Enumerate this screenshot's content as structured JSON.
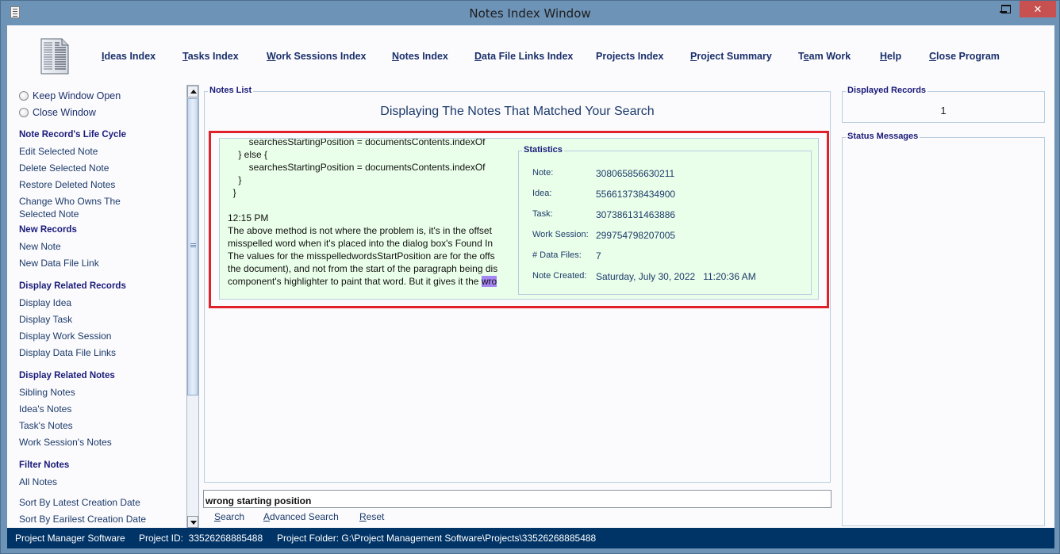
{
  "window": {
    "title": "Notes Index Window"
  },
  "nav": [
    {
      "label": "Ideas Index",
      "mnemonic": "I"
    },
    {
      "label": "Tasks Index",
      "mnemonic": "T"
    },
    {
      "label": "Work Sessions Index",
      "mnemonic": "W"
    },
    {
      "label": "Notes Index",
      "mnemonic": "N"
    },
    {
      "label": "Data File Links Index",
      "mnemonic": "D"
    },
    {
      "label": "Projects Index",
      "mnemonic": ""
    },
    {
      "label": "Project Summary",
      "mnemonic": "P"
    },
    {
      "label": "Team Work",
      "mnemonic": "e"
    },
    {
      "label": "Help",
      "mnemonic": "H"
    },
    {
      "label": "Close Program",
      "mnemonic": "C"
    }
  ],
  "sidebar": {
    "radios": [
      {
        "label": "Keep Window Open",
        "selected": false
      },
      {
        "label": "Close Window",
        "selected": false
      }
    ],
    "sections": [
      {
        "heading": "Note Record's Life Cycle",
        "items": [
          "Edit Selected Note",
          "Delete Selected Note",
          "Restore Deleted Notes",
          "Change Who Owns The Selected Note"
        ]
      },
      {
        "heading": "New Records",
        "items": [
          "New Note",
          "New Data File Link"
        ]
      },
      {
        "heading": "Display Related Records",
        "items": [
          "Display Idea",
          "Display Task",
          "Display Work Session",
          "Display Data File Links"
        ]
      },
      {
        "heading": "Display Related Notes",
        "items": [
          "Sibling Notes",
          "Idea's Notes",
          "Task's Notes",
          "Work Session's Notes"
        ]
      },
      {
        "heading": "Filter Notes",
        "items": [
          "All Notes",
          "Sort By Latest Creation Date",
          "Sort By Earilest Creation Date"
        ]
      }
    ]
  },
  "notes_list": {
    "legend": "Notes List",
    "heading": "Displaying The Notes That Matched Your Search",
    "note": {
      "text_lines": [
        "        searchesStartingPosition = documentsContents.indexOf",
        "    } else {",
        "        searchesStartingPosition = documentsContents.indexOf",
        "    }",
        "  }",
        "",
        "12:15 PM",
        "The above method is not where the problem is, it's in the offset",
        "misspelled word when it's placed into the dialog box's Found In",
        "The values for the misspelledwordsStartPosition are for the offs",
        "the document), and not from the start of the paragraph being dis",
        "component's highlighter to paint that word. But it gives it the "
      ],
      "highlighted_text": "wro",
      "highlight_color": "#a584f3"
    },
    "statistics": {
      "legend": "Statistics",
      "rows": [
        {
          "label": "Note:",
          "value": "308065856630211"
        },
        {
          "label": "Idea:",
          "value": "556613738434900"
        },
        {
          "label": "Task:",
          "value": "307386131463886"
        },
        {
          "label": "Work Session:",
          "value": "299754798207005"
        },
        {
          "label": "# Data Files:",
          "value": "7"
        },
        {
          "label": "Note Created:",
          "value": "Saturday, July 30, 2022   11:20:36 AM"
        }
      ]
    }
  },
  "search": {
    "value": "wrong starting position",
    "actions": [
      {
        "label": "Search",
        "mnemonic": "S"
      },
      {
        "label": "Advanced Search",
        "mnemonic": "A"
      },
      {
        "label": "Reset",
        "mnemonic": "R"
      }
    ]
  },
  "displayed_records": {
    "legend": "Displayed Records",
    "value": "1"
  },
  "status_messages": {
    "legend": "Status Messages"
  },
  "statusbar": {
    "app_name": "Project Manager Software",
    "project_id": "Project ID:  33526268885488",
    "project_folder": "Project Folder: G:\\Project Management Software\\Projects\\33526268885488"
  },
  "colors": {
    "highlight_frame": "#e0202a",
    "statusbar_bg": "#003366",
    "note_bg": "#eaffea",
    "title_bar": "#6d93b7"
  }
}
